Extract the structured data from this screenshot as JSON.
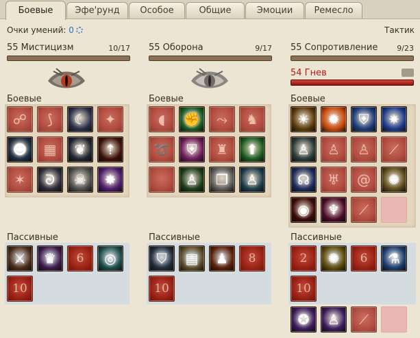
{
  "tabs": [
    "Боевые",
    "Эфе'рунд",
    "Особое",
    "Общие",
    "Эмоции",
    "Ремесло"
  ],
  "header": {
    "points_label": "Очки умений:",
    "points_value": "0",
    "role": "Тактик"
  },
  "columns": [
    {
      "title": "55 Мистицизм",
      "count": "10/17",
      "progress": 1.0,
      "combat_label": "Боевые",
      "passive_label": "Пассивные",
      "combat": [
        {
          "style": "dim",
          "icon": "mystic-rune-icon",
          "g": "☍"
        },
        {
          "style": "dim",
          "icon": "claw-icon",
          "g": "⟆"
        },
        {
          "style": "bright",
          "icon": "shadow-figure-icon",
          "bg": "#2a2f48",
          "g": "☾"
        },
        {
          "style": "dim",
          "icon": "bind-icon",
          "g": "✦"
        },
        {
          "style": "bright",
          "icon": "dark-aura-icon",
          "bg": "#1c2c40",
          "g": "☻"
        },
        {
          "style": "dim",
          "icon": "net-icon",
          "g": "▦"
        },
        {
          "style": "bright",
          "icon": "raven-icon",
          "bg": "#1e2430",
          "g": "❦"
        },
        {
          "style": "bright",
          "icon": "dark-spike-icon",
          "bg": "#3a1008",
          "g": "⇡"
        },
        {
          "style": "dim",
          "icon": "crack-icon",
          "g": "✶"
        },
        {
          "style": "bright",
          "icon": "whirl-icon",
          "bg": "#2a2a36",
          "g": "ᘐ"
        },
        {
          "style": "bright",
          "icon": "skull-icon",
          "bg": "#4a4a4a",
          "g": "☠"
        },
        {
          "style": "bright",
          "icon": "purple-burst-icon",
          "bg": "#4a1a6a",
          "g": "✸"
        }
      ],
      "passive": [
        {
          "style": "bright",
          "icon": "blades-icon",
          "bg": "#4a2a18",
          "g": "⚔"
        },
        {
          "style": "bright",
          "icon": "hooded-mage-icon",
          "bg": "#3a1a4a",
          "g": "♛"
        },
        {
          "style": "num",
          "n": "6"
        },
        {
          "style": "bright",
          "icon": "green-wave-icon",
          "bg": "#1a4a4a",
          "g": "◎"
        },
        {
          "style": "num",
          "n": "10"
        }
      ]
    },
    {
      "title": "55 Оборона",
      "count": "9/17",
      "progress": 1.0,
      "combat_label": "Боевые",
      "passive_label": "Пассивные",
      "combat": [
        {
          "style": "dim",
          "icon": "shield-bash-icon",
          "g": "◖"
        },
        {
          "style": "bright",
          "icon": "green-strike-icon",
          "bg": "#1d5a24",
          "g": "✊"
        },
        {
          "style": "dim",
          "icon": "charge-icon",
          "g": "⤳"
        },
        {
          "style": "dim",
          "icon": "helm-icon",
          "g": "♞"
        },
        {
          "style": "dim",
          "icon": "lasso-icon",
          "g": "➰"
        },
        {
          "style": "bright",
          "icon": "pink-shield-icon",
          "bg": "#6a1a58",
          "g": "⛨"
        },
        {
          "style": "dim",
          "icon": "warrior-icon",
          "g": "♜"
        },
        {
          "style": "bright",
          "icon": "green-arrow-icon",
          "bg": "#1a5a20",
          "g": "⬆"
        },
        {
          "style": "dim",
          "icon": "red-blank-icon",
          "g": ""
        },
        {
          "style": "bright",
          "icon": "green-man-icon",
          "bg": "#1a3a1a",
          "g": "♙"
        },
        {
          "style": "bright",
          "icon": "cube-icon",
          "bg": "#5a5a58",
          "g": "❒"
        },
        {
          "style": "bright",
          "icon": "flex-icon",
          "bg": "#1a3a4a",
          "g": "♙"
        }
      ],
      "passive": [
        {
          "style": "bright",
          "icon": "dark-shield-icon",
          "bg": "#1e2a3a",
          "g": "⛉"
        },
        {
          "style": "bright",
          "icon": "chest-icon",
          "bg": "#5a4a2a",
          "g": "▤"
        },
        {
          "style": "bright",
          "icon": "fire-warrior-icon",
          "bg": "#5a1e0a",
          "g": "♟"
        },
        {
          "style": "num",
          "n": "8"
        },
        {
          "style": "num",
          "n": "10"
        }
      ]
    },
    {
      "title": "55 Сопротивление",
      "count": "9/23",
      "progress": 1.0,
      "rage_label": "54 Гнев",
      "rage_progress": 1.0,
      "combat_label": "Боевые",
      "passive_label": "Пассивные",
      "combat": [
        {
          "style": "bright",
          "icon": "golden-aura-icon",
          "bg": "#5a3a0a",
          "g": "☀"
        },
        {
          "style": "bright",
          "icon": "explosion-icon",
          "bg": "#c8480a",
          "g": "✹"
        },
        {
          "style": "bright",
          "icon": "blue-shield-icon",
          "bg": "#1a3a7a",
          "g": "⛨"
        },
        {
          "style": "bright",
          "icon": "blue-star-icon",
          "bg": "#1a3a8a",
          "g": "✷"
        },
        {
          "style": "bright",
          "icon": "meditate-icon",
          "bg": "#2a3a3a",
          "g": "♙"
        },
        {
          "style": "dim",
          "icon": "shadow-pose-icon",
          "g": "♙"
        },
        {
          "style": "dim",
          "icon": "red-figure-icon",
          "g": "♙"
        },
        {
          "style": "dim",
          "icon": "slash-icon",
          "g": "⟋"
        },
        {
          "style": "bright",
          "icon": "blue-head-icon",
          "bg": "#1a2a5a",
          "g": "☊"
        },
        {
          "style": "dim",
          "icon": "demon-face-icon",
          "g": "♅"
        },
        {
          "style": "dim",
          "icon": "spiral-icon",
          "g": "@"
        },
        {
          "style": "bright",
          "icon": "golden-orb-icon",
          "bg": "#5a4a1a",
          "g": "✺"
        },
        {
          "style": "bright",
          "icon": "vortex-icon",
          "bg": "#3a0a0a",
          "g": "◉"
        },
        {
          "style": "bright",
          "icon": "demon-icon",
          "bg": "#4a0a2a",
          "g": "♆"
        },
        {
          "style": "dim",
          "icon": "slash-red-icon",
          "g": "⟋"
        },
        {
          "style": "empty"
        }
      ],
      "passive": [
        {
          "style": "num",
          "n": "2"
        },
        {
          "style": "bright",
          "icon": "golden-swirl-icon",
          "bg": "#5a4a0a",
          "g": "✺"
        },
        {
          "style": "num",
          "n": "6"
        },
        {
          "style": "bright",
          "icon": "potion-icon",
          "bg": "#1a3a6a",
          "g": "⚗"
        },
        {
          "style": "num",
          "n": "10"
        }
      ],
      "extra": [
        {
          "style": "bright",
          "icon": "pink-orb-icon",
          "bg": "#3a1a5a",
          "g": "✪"
        },
        {
          "style": "bright",
          "icon": "purple-figure-icon",
          "bg": "#3a1a5a",
          "g": "♙"
        },
        {
          "style": "dim",
          "icon": "red-slash-icon",
          "g": "⟋"
        },
        {
          "style": "empty"
        }
      ]
    }
  ]
}
